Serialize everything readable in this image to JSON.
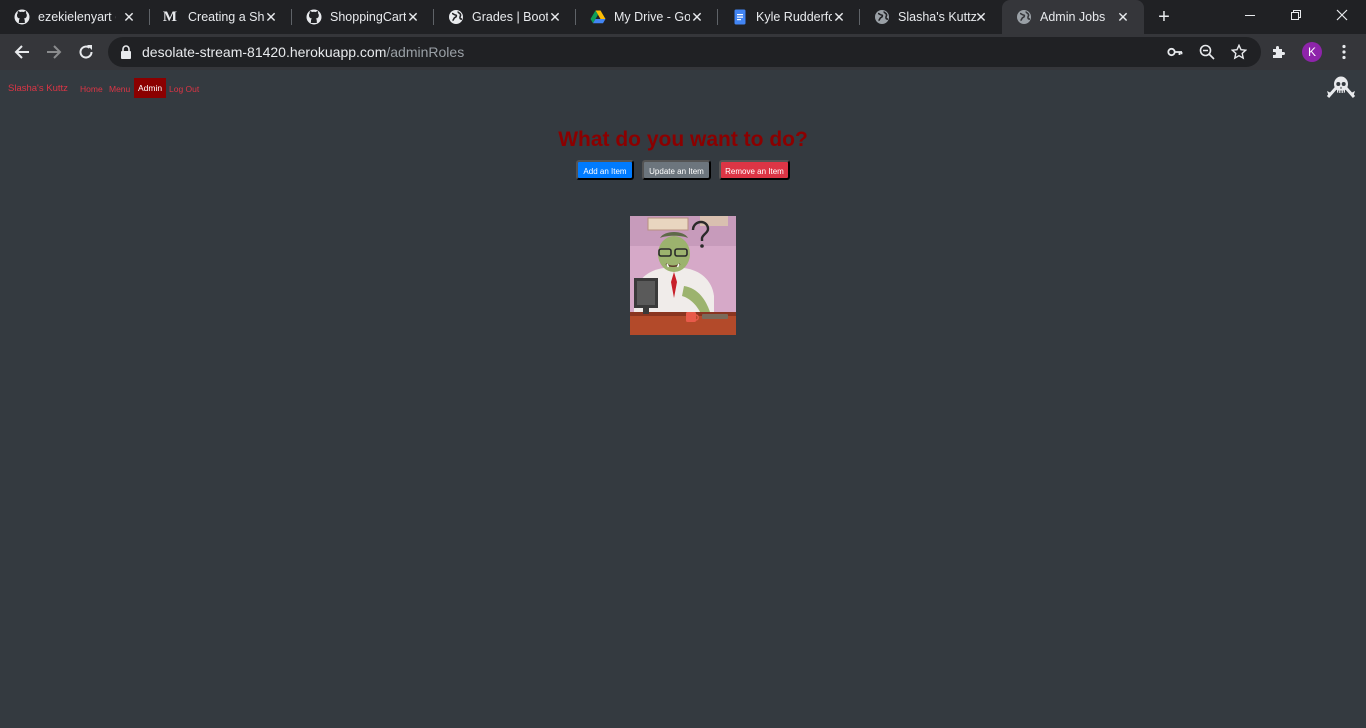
{
  "browser": {
    "tabs": [
      {
        "title": "ezekielenyart (",
        "favicon": "github-icon"
      },
      {
        "title": "Creating a Sho",
        "favicon": "medium-icon"
      },
      {
        "title": "ShoppingCartV",
        "favicon": "github-icon"
      },
      {
        "title": "Grades | Boot",
        "favicon": "globe-icon"
      },
      {
        "title": "My Drive - Goo",
        "favicon": "google-drive-icon"
      },
      {
        "title": "Kyle Rudderfor",
        "favicon": "google-docs-icon"
      },
      {
        "title": "Slasha's Kuttz",
        "favicon": "globe-icon"
      },
      {
        "title": "Admin Jobs",
        "favicon": "globe-icon",
        "active": true
      }
    ],
    "url_host": "desolate-stream-81420.herokuapp.com",
    "url_path": "/adminRoles",
    "profile_initial": "K"
  },
  "site": {
    "brand": "Slasha's Kuttz",
    "nav": [
      {
        "label": "Home",
        "active": false
      },
      {
        "label": "Menu",
        "active": false
      },
      {
        "label": "Admin",
        "active": true
      },
      {
        "label": "Log Out",
        "active": false
      }
    ]
  },
  "main": {
    "heading": "What do you want to do?",
    "buttons": {
      "add": "Add an Item",
      "update": "Update an Item",
      "remove": "Remove an Item"
    }
  },
  "colors": {
    "page_bg": "#343a40",
    "brand_red": "#dc3545",
    "heading_red": "#8b0000",
    "primary": "#007bff",
    "secondary": "#6c757d"
  }
}
